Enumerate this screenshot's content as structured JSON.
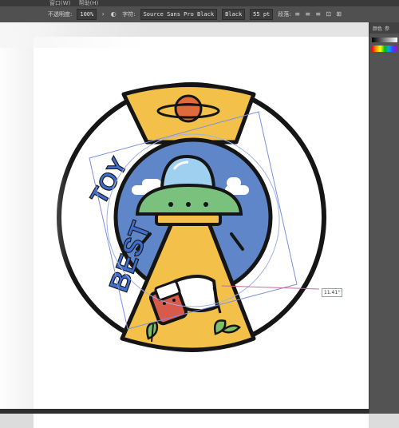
{
  "menubar": {
    "items": [
      "窗口(W)",
      "帮助(H)"
    ]
  },
  "controlbar": {
    "opacity_label": "不透明度:",
    "opacity_value": "100%",
    "font_label": "字符:",
    "font_family": "Source Sans Pro Black",
    "font_style": "Black",
    "font_size": "55 pt",
    "paragraph_label": "段落:"
  },
  "panel": {
    "color_tab": "颜色",
    "guide_tab": "参"
  },
  "artwork": {
    "text_line1": "BEST",
    "text_line2": "TOY",
    "colors": {
      "ring": "#151515",
      "yellow": "#f3c14a",
      "blue": "#5f86c8",
      "ufo_green": "#7bc17e",
      "dome": "#9fd0f0",
      "planet": "#e06a3a",
      "cow_red": "#d85a4a",
      "leaf": "#7fbf6a",
      "text_blue": "#3e6fd0"
    }
  },
  "rotate_readout": "11.41°"
}
